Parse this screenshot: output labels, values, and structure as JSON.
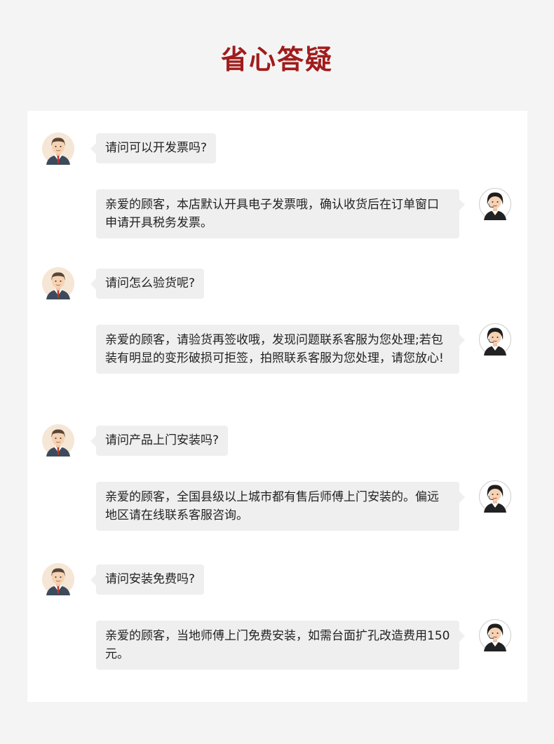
{
  "title": "省心答疑",
  "colors": {
    "title": "#a11c1c",
    "bubble": "#efefef",
    "card": "#ffffff",
    "background": "#f4f4f4"
  },
  "icons": {
    "customer": "customer-avatar-icon",
    "service": "service-agent-avatar-icon"
  },
  "faq": [
    {
      "question": "请问可以开发票吗?",
      "answer": "亲爱的顾客，本店默认开具电子发票哦，确认收货后在订单窗口申请开具税务发票。"
    },
    {
      "question": "请问怎么验货呢?",
      "answer": "亲爱的顾客，请验货再签收哦，发现问题联系客服为您处理;若包装有明显的变形破损可拒签，拍照联系客服为您处理，请您放心!"
    },
    {
      "question": "请问产品上门安装吗?",
      "answer": "亲爱的顾客，全国县级以上城市都有售后师傅上门安装的。偏远地区请在线联系客服咨询。"
    },
    {
      "question": "请问安装免费吗?",
      "answer": "亲爱的顾客，当地师傅上门免费安装，如需台面扩孔改造费用150元。"
    }
  ]
}
